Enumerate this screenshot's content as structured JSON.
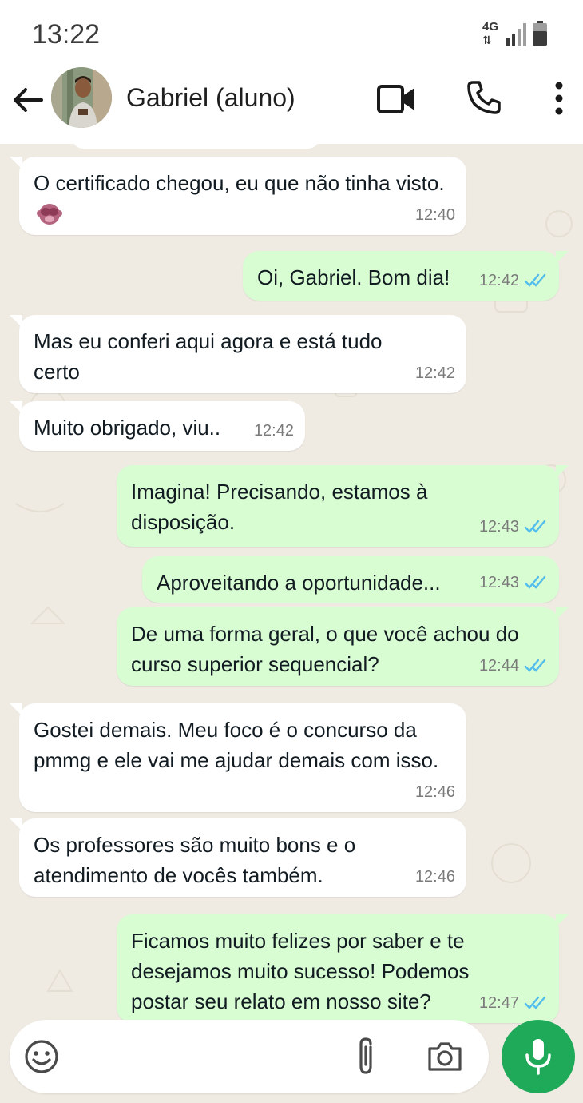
{
  "status_bar": {
    "time": "13:22",
    "network": "4G",
    "icons": [
      "network-4g-icon",
      "signal-icon",
      "battery-icon"
    ]
  },
  "header": {
    "contact_name": "Gabriel (aluno)",
    "icons": [
      "back-arrow-icon",
      "avatar",
      "video-call-icon",
      "phone-call-icon",
      "more-options-icon"
    ]
  },
  "messages": [
    {
      "direction": "in",
      "text": "O certificado chegou, eu que não tinha visto.",
      "emoji": "see-no-evil-monkey",
      "time": "12:40"
    },
    {
      "direction": "out",
      "text": "Oi, Gabriel. Bom dia!",
      "time": "12:42",
      "status": "read"
    },
    {
      "direction": "in",
      "text": "Mas eu conferi aqui agora e está tudo certo",
      "time": "12:42"
    },
    {
      "direction": "in",
      "text": "Muito obrigado, viu..",
      "time": "12:42"
    },
    {
      "direction": "out",
      "text": "Imagina! Precisando, estamos à disposição.",
      "time": "12:43",
      "status": "read"
    },
    {
      "direction": "out",
      "text": "Aproveitando a oportunidade...",
      "time": "12:43",
      "status": "read"
    },
    {
      "direction": "out",
      "text": "De uma forma geral, o que você achou do curso superior sequencial?",
      "time": "12:44",
      "status": "read"
    },
    {
      "direction": "in",
      "text": "Gostei demais. Meu foco é o concurso da pmmg e ele vai me ajudar demais com isso.",
      "time": "12:46"
    },
    {
      "direction": "in",
      "text": "Os professores são muito bons e o atendimento de vocês também.",
      "time": "12:46"
    },
    {
      "direction": "out",
      "text": "Ficamos muito felizes por saber e te desejamos muito sucesso! Podemos postar seu relato em nosso site?",
      "time": "12:47",
      "status": "read"
    }
  ],
  "input_bar": {
    "placeholder": "",
    "icons": [
      "emoji-icon",
      "attach-icon",
      "camera-icon",
      "mic-icon"
    ]
  },
  "colors": {
    "outgoing_bubble": "#d9fdd3",
    "incoming_bubble": "#ffffff",
    "chat_background": "#efeae2",
    "read_ticks": "#53bdeb",
    "mic_button": "#1faa59"
  }
}
